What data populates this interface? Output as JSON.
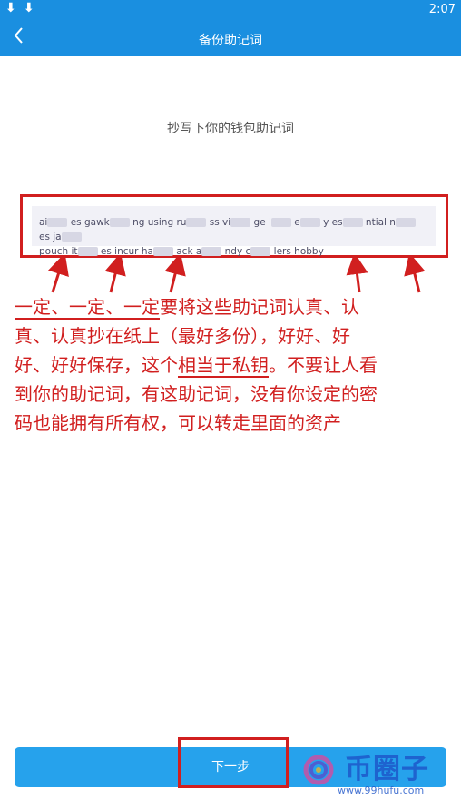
{
  "status_bar": {
    "download_icon_1": "⬇",
    "download_icon_2": "⬇",
    "time": "2:07"
  },
  "app_bar": {
    "back_icon": "back-chevron-icon",
    "title": "备份助记词"
  },
  "prompt": "抄写下你的钱包助记词",
  "mnemonic": {
    "line1_a": "ai",
    "line1_b": "es gawk",
    "line1_c": "ng using ru",
    "line1_d": "ss vi",
    "line1_e": "ge i",
    "line1_f": "e",
    "line1_g": "y es",
    "line1_h": "ntial n",
    "line1_i": "es ja",
    "line2_a": "pouch it",
    "line2_b": "es incur ha",
    "line2_c": "ack a",
    "line2_d": "ndy c",
    "line2_e": "lers hobby"
  },
  "annotation": {
    "line1_u1": "一定、一定、一定",
    "line1_rest": "要将这些助记词认真、认",
    "line2": "真、认真抄在纸上（最好多份），好好、好",
    "line3_a": "好、好好保存，这个",
    "line3_u": "相当于私钥",
    "line3_b": "。不要让人看",
    "line4": "到你的助记词，有这助记词，没有你设定的密",
    "line5": "码也能拥有所有权，可以转走里面的资产"
  },
  "next_button": "下一步",
  "watermark": {
    "name": "币圈子",
    "url": "www.99hufu.com"
  },
  "colors": {
    "primary": "#1a8fe0",
    "button": "#26a2ec",
    "annotation_red": "#d11f1f"
  }
}
